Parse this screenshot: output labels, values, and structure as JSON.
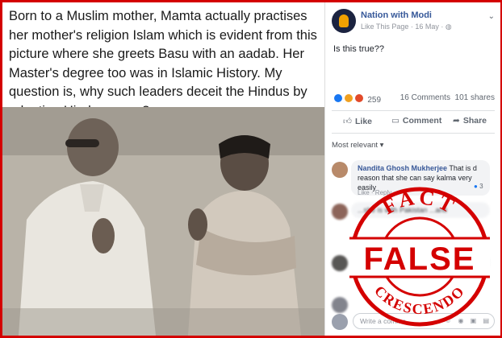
{
  "post_image": {
    "caption": "Born to a Muslim mother, Mamta actually practises her mother's religion Islam which is evident from this picture where she greets Basu with an aadab. Her Master's degree too was in Islamic History. My question is, why such leaders deceit the Hindus by adopting Hindu names?"
  },
  "page": {
    "name": "Nation with Modi",
    "like_label": "Like This Page",
    "date": "16 May",
    "post_text": "Is this true??"
  },
  "stats": {
    "reaction_count": "259",
    "comments": "16 Comments",
    "shares": "101 shares"
  },
  "actions": {
    "like": "Like",
    "comment": "Comment",
    "share": "Share"
  },
  "comments_filter": "Most relevant ▾",
  "comments": [
    {
      "name": "Nandita Ghosh Mukherjee",
      "text": "That is d reason that she can say kalma very easily",
      "actions": "Like · Reply",
      "reactions": "3"
    },
    {
      "name": "",
      "text": "...she is with Pakistan ...anti",
      "actions": ""
    }
  ],
  "write_placeholder": "Write a comme",
  "stamp": {
    "top": "FACT",
    "main": "FALSE",
    "bottom": "CRESCENDO",
    "color": "#d40000"
  }
}
